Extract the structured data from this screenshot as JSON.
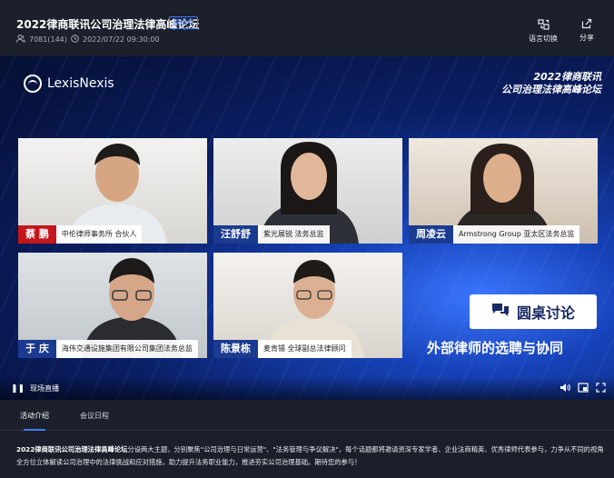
{
  "header": {
    "title": "2022律商联讯公司治理法律高峰论坛",
    "live_badge": "直播中",
    "viewers": "7081(144)",
    "datetime": "2022/07/22 09:30:00",
    "language_button": "语言切换",
    "share_button": "分享"
  },
  "stage": {
    "logo_text": "LexisNexis",
    "event_title_line1": "2022律商联讯",
    "event_title_line2": "公司治理法律高峰论坛",
    "roundtable_label": "圆桌讨论",
    "topic": "外部律师的选聘与协同",
    "speakers": [
      {
        "name": "蔡  鹏",
        "role": "中伦律师事务所 合伙人"
      },
      {
        "name": "汪舒舒",
        "role": "紫光展锐 法务总监"
      },
      {
        "name": "周凌云",
        "role": "Armstrong Group 亚太区法务总监"
      },
      {
        "name": "于  庆",
        "role": "海伟交通设施集团有限公司集团法务总监"
      },
      {
        "name": "陈景栋",
        "role": "麦肯锡 全球副总法律顾问"
      }
    ],
    "live_label": "现场直播"
  },
  "tabs": [
    {
      "label": "活动介绍"
    },
    {
      "label": "会议日程"
    }
  ],
  "description": {
    "lead": "2022律商联讯公司治理法律高峰论坛",
    "body": "分设两大主题，分别聚焦\"公司治理与日常运营\"、\"法务管理与争议解决\"，每个话题都将邀请资深专家学者、企业法商精英、优秀律师代表参与，力争从不同的视角全方位立体解读公司治理中的法律挑战和应对措施，助力提升法务职业能力，推进夯实公司治理基础。期待您的参与！"
  },
  "colors": {
    "accent": "#3e78ff",
    "name_red": "#c4161c",
    "name_blue": "#1a3b8f"
  }
}
